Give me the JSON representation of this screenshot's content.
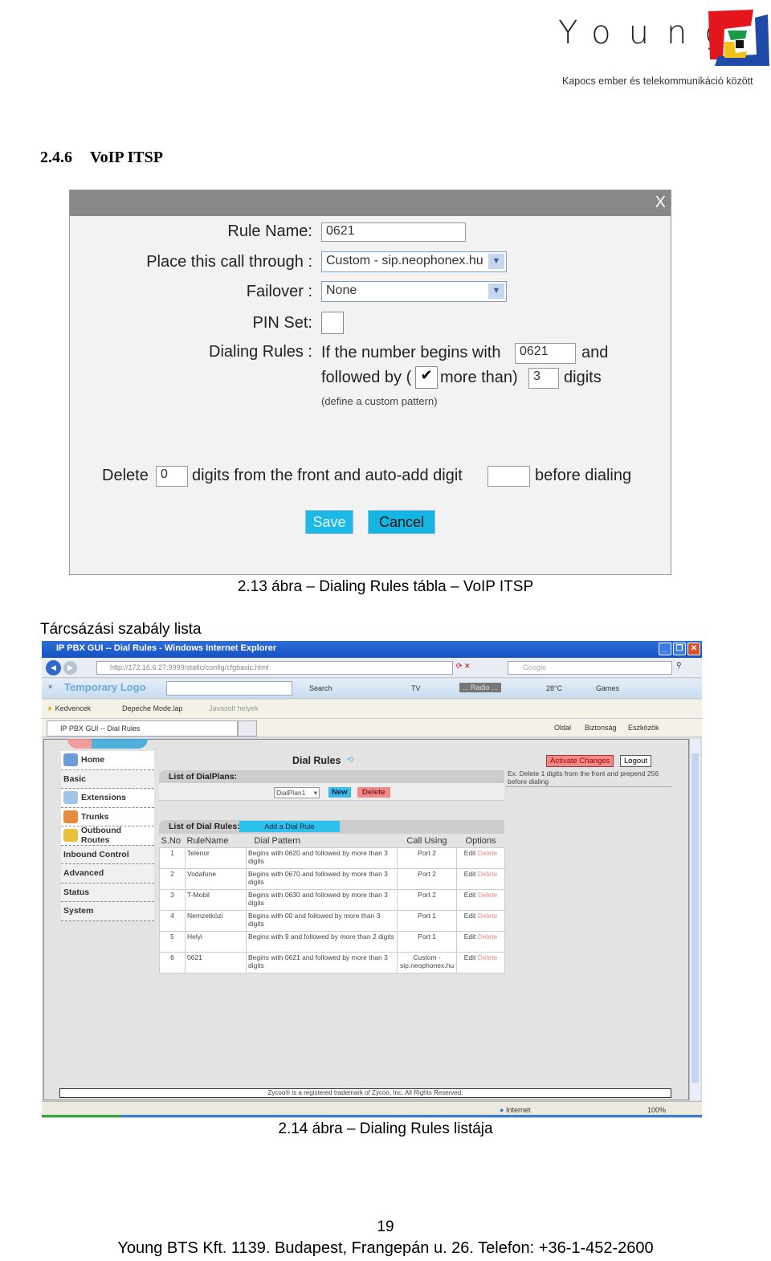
{
  "logo": {
    "brand": "Young",
    "tagline": "Kapocs ember és telekommunikáció között",
    "colors": [
      "#e3161d",
      "#1f4aa8",
      "#f3c21a",
      "#1a9a4a"
    ]
  },
  "section": {
    "number": "2.4.6",
    "title": "VoIP ITSP"
  },
  "dialog": {
    "close": "X",
    "rule_name_label": "Rule Name:",
    "rule_name_value": "0621",
    "place_call_label": "Place this call through :",
    "place_call_value": "Custom - sip.neophonex.hu",
    "failover_label": "Failover :",
    "failover_value": "None",
    "pin_label": "PIN Set:",
    "pin_checked": false,
    "dialing_label": "Dialing Rules :",
    "begins_text": "If the number begins with",
    "begins_value": "0621",
    "and_text": "and",
    "followed_text": "followed by (",
    "more_than_text": "more than)",
    "more_than_checked": true,
    "digits_value": "3",
    "digits_text": "digits",
    "custom_pattern": "(define a custom pattern)",
    "delete_text": "Delete",
    "delete_value": "0",
    "digits_front_text": "digits from the front and auto-add digit",
    "auto_add_value": "",
    "before_text": "before dialing",
    "save": "Save",
    "cancel": "Cancel"
  },
  "caption1": "2.13 ábra – Dialing Rules tábla – VoIP ITSP",
  "subheading": "Tárcsázási szabály lista",
  "browser": {
    "title": "IP PBX GUI -- Dial Rules - Windows Internet Explorer",
    "url": "http://172.16.6.27:9999/static/config/cfgbasic.html",
    "search_placeholder": "Google",
    "toolbar": {
      "logo": "Temporary Logo",
      "search": "Search",
      "tv": "TV",
      "radio": "... Radio ...",
      "temp": "28°C",
      "games": "Games"
    },
    "favorites": {
      "label": "Kedvencek",
      "item1": "Depeche Mode.lap",
      "item2": "Javasolt helyek"
    },
    "tab": "IP PBX GUI -- Dial Rules",
    "commands": {
      "page": "Oldal",
      "security": "Biztonság",
      "tools": "Eszközök"
    },
    "status": {
      "zone": "Internet",
      "zoom": "100%"
    }
  },
  "app": {
    "nav": [
      "Home",
      "Basic",
      "Extensions",
      "Trunks",
      "Outbound Routes",
      "Inbound Control",
      "Advanced",
      "Status",
      "System"
    ],
    "page_title": "Dial Rules",
    "activate": "Activate Changes",
    "logout": "Logout",
    "hint": "Ex: Delete 1 digits from the front and prepend 256 before dialing",
    "dialplans_label": "List of DialPlans:",
    "dialplan_value": "DialPlan1",
    "new": "New",
    "delete": "Delete",
    "rules_label": "List of Dial Rules:",
    "add_rule": "Add a Dial Rule",
    "columns": [
      "S.No",
      "RuleName",
      "Dial Pattern",
      "Call Using",
      "Options"
    ],
    "rows": [
      {
        "no": "1",
        "name": "Telenor",
        "pattern": "Begins with 0620 and followed by more than 3 digits",
        "using": "Port 2"
      },
      {
        "no": "2",
        "name": "Vodafone",
        "pattern": "Begins with 0670 and followed by more than 3 digits",
        "using": "Port 2"
      },
      {
        "no": "3",
        "name": "T-Mobil",
        "pattern": "Begins with 0630 and followed by more than 3 digits",
        "using": "Port 2"
      },
      {
        "no": "4",
        "name": "Nemzetközi",
        "pattern": "Begins with 00 and followed by more than 3 digits",
        "using": "Port 1"
      },
      {
        "no": "5",
        "name": "Helyi",
        "pattern": "Begins with 9 and followed by more than 2 digits",
        "using": "Port 1"
      },
      {
        "no": "6",
        "name": "0621",
        "pattern": "Begins with 0621 and followed by more than 3 digits",
        "using": "Custom - sip.neophonex.hu"
      }
    ],
    "edit": "Edit",
    "row_delete": "Delete",
    "copyright": "Zycoo® is a registered trademark of Zycoo, Inc. All Rights Reserved."
  },
  "caption2": "2.14 ábra – Dialing Rules listája",
  "page_number": "19",
  "footer": "Young BTS Kft. 1139. Budapest, Frangepán u. 26. Telefon: +36-1-452-2600"
}
